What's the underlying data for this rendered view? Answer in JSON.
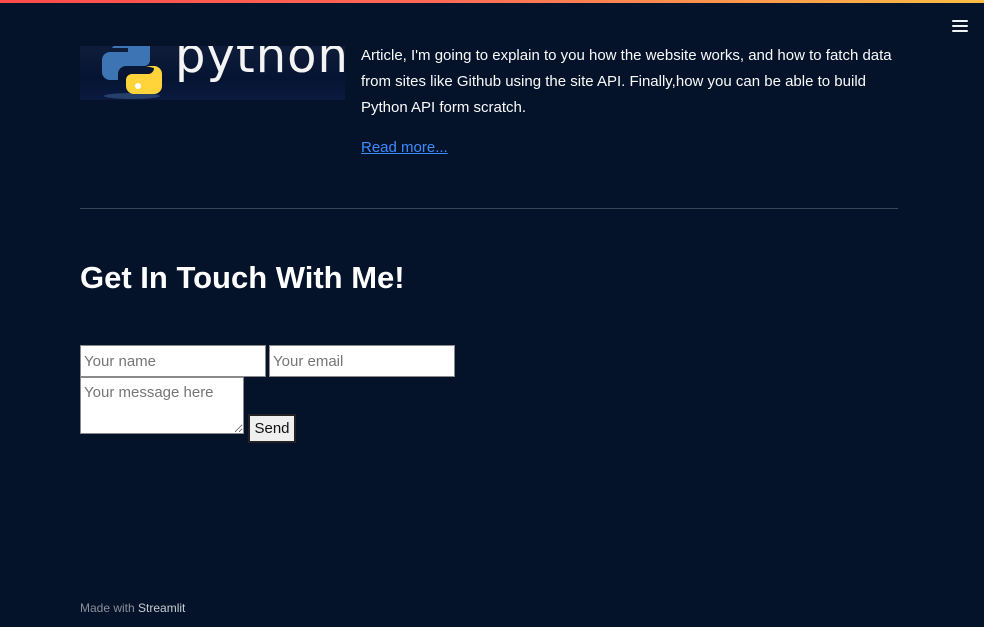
{
  "header": {
    "menu_icon": "hamburger-menu-icon",
    "accent_gradient": [
      "#ff4b4b",
      "#ffbd45"
    ]
  },
  "article": {
    "thumbnail_word": "python",
    "text": "Article, I'm going to explain to you how the website works, and how to fatch data from sites like Github using the site API. Finally,how you can be able to build Python API form scratch.",
    "read_more_label": "Read more..."
  },
  "contact": {
    "heading": "Get In Touch With Me!",
    "name_placeholder": "Your name",
    "email_placeholder": "Your email",
    "message_placeholder": "Your message here",
    "send_label": "Send"
  },
  "footer": {
    "prefix": "Made with",
    "brand": "Streamlit"
  },
  "colors": {
    "background": "#04132a",
    "link": "#3d8bfd",
    "text": "#fafafa"
  }
}
